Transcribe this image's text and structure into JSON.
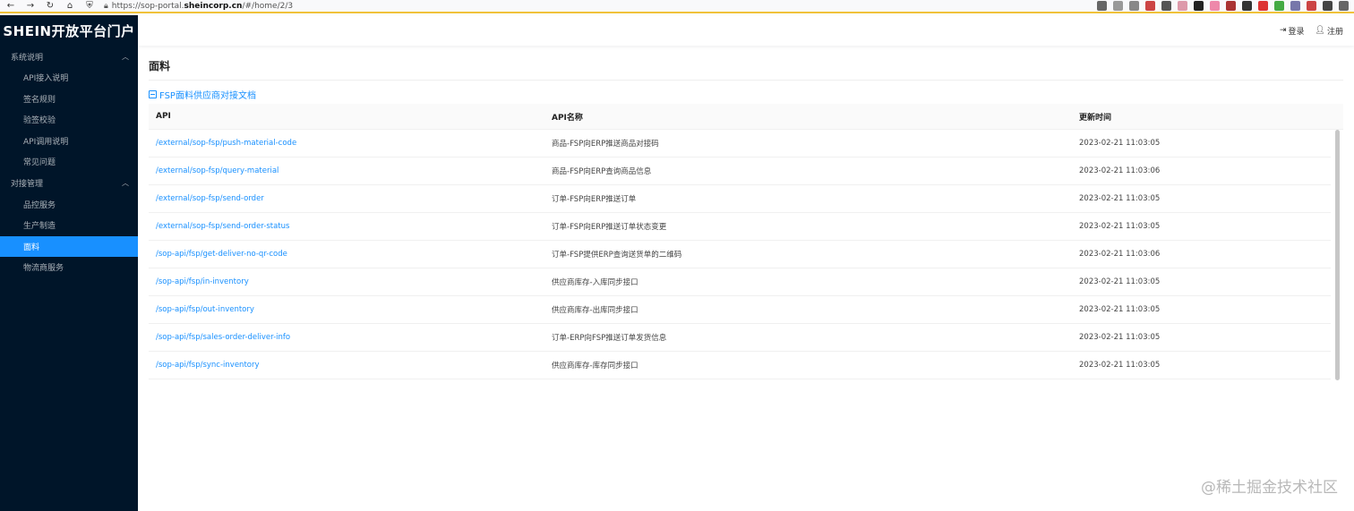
{
  "browser": {
    "url_prefix": "https://sop-portal.",
    "url_domain": "sheincorp.cn",
    "url_path": "/#/home/2/3"
  },
  "sidebar": {
    "logo": "SHEIN开放平台门户",
    "groups": [
      {
        "label": "系统说明",
        "items": [
          "API接入说明",
          "签名规则",
          "验签校验",
          "API调用说明",
          "常见问题"
        ]
      },
      {
        "label": "对接管理",
        "items": [
          "品控服务",
          "生产制造",
          "面料",
          "物流商服务"
        ]
      }
    ],
    "active_item": "面料"
  },
  "header": {
    "login": "登录",
    "register": "注册"
  },
  "main": {
    "title": "面料",
    "doc_link": "FSP面料供应商对接文档",
    "table": {
      "columns": [
        "API",
        "API名称",
        "更新时间"
      ],
      "rows": [
        [
          "/external/sop-fsp/push-material-code",
          "商品-FSP向ERP推送商品对接码",
          "2023-02-21 11:03:05"
        ],
        [
          "/external/sop-fsp/query-material",
          "商品-FSP向ERP查询商品信息",
          "2023-02-21 11:03:06"
        ],
        [
          "/external/sop-fsp/send-order",
          "订单-FSP向ERP推送订单",
          "2023-02-21 11:03:05"
        ],
        [
          "/external/sop-fsp/send-order-status",
          "订单-FSP向ERP推送订单状态变更",
          "2023-02-21 11:03:05"
        ],
        [
          "/sop-api/fsp/get-deliver-no-qr-code",
          "订单-FSP提供ERP查询送货单的二维码",
          "2023-02-21 11:03:06"
        ],
        [
          "/sop-api/fsp/in-inventory",
          "供应商库存-入库同步接口",
          "2023-02-21 11:03:05"
        ],
        [
          "/sop-api/fsp/out-inventory",
          "供应商库存-出库同步接口",
          "2023-02-21 11:03:05"
        ],
        [
          "/sop-api/fsp/sales-order-deliver-info",
          "订单-ERP向FSP推送订单发货信息",
          "2023-02-21 11:03:05"
        ],
        [
          "/sop-api/fsp/sync-inventory",
          "供应商库存-库存同步接口",
          "2023-02-21 11:03:05"
        ]
      ]
    }
  },
  "watermark": "@稀土掘金技术社区"
}
